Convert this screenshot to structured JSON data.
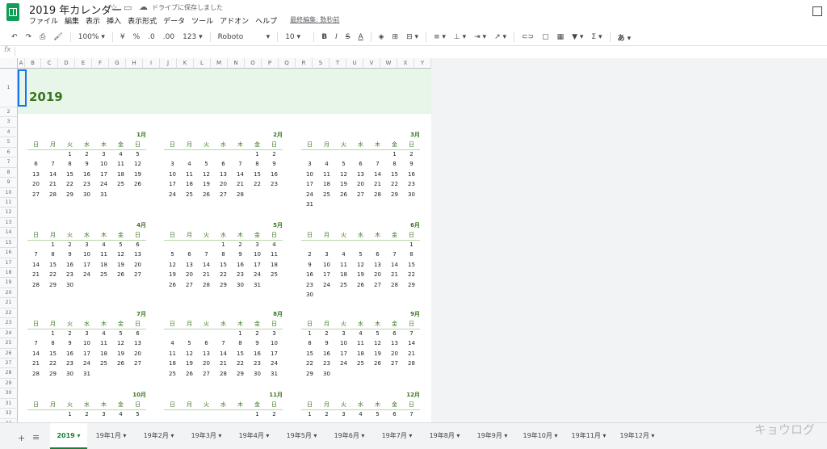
{
  "doc": {
    "title": "2019 年カレンダー",
    "save_status": "ドライブに保存しました",
    "menus": [
      "ファイル",
      "編集",
      "表示",
      "挿入",
      "表示形式",
      "データ",
      "ツール",
      "アドオン",
      "ヘルプ"
    ],
    "last_edit": "最終編集: 数秒前"
  },
  "toolbar": {
    "zoom": "100%",
    "currency": "¥",
    "percent": "%",
    "dec_less": ".0",
    "dec_more": ".00",
    "more_formats": "123",
    "font": "Roboto",
    "font_size": "10",
    "bold": "B",
    "italic": "I",
    "strike": "S",
    "text_color": "A",
    "input_tools": "あ"
  },
  "formula_bar": {
    "label": "fx",
    "value": ""
  },
  "grid": {
    "columns": [
      "A",
      "B",
      "C",
      "D",
      "E",
      "F",
      "G",
      "H",
      "I",
      "J",
      "K",
      "L",
      "M",
      "N",
      "O",
      "P",
      "Q",
      "R",
      "S",
      "T",
      "U",
      "V",
      "W",
      "X",
      "Y"
    ],
    "rows": [
      "1",
      "2",
      "3",
      "4",
      "5",
      "6",
      "7",
      "8",
      "9",
      "10",
      "11",
      "12",
      "13",
      "14",
      "15",
      "16",
      "17",
      "18",
      "19",
      "20",
      "21",
      "22",
      "23",
      "24",
      "25",
      "26",
      "27",
      "28",
      "29",
      "30",
      "31",
      "32",
      "33"
    ]
  },
  "calendar": {
    "year": "2019",
    "weekday_labels": [
      "日",
      "月",
      "火",
      "水",
      "木",
      "金",
      "日"
    ],
    "months": [
      {
        "label": "1月",
        "weeks": [
          [
            "",
            "",
            "1",
            "2",
            "3",
            "4",
            "5"
          ],
          [
            "6",
            "7",
            "8",
            "9",
            "10",
            "11",
            "12"
          ],
          [
            "13",
            "14",
            "15",
            "16",
            "17",
            "18",
            "19"
          ],
          [
            "20",
            "21",
            "22",
            "23",
            "24",
            "25",
            "26"
          ],
          [
            "27",
            "28",
            "29",
            "30",
            "31",
            "",
            ""
          ]
        ]
      },
      {
        "label": "2月",
        "weeks": [
          [
            "",
            "",
            "",
            "",
            "",
            "1",
            "2"
          ],
          [
            "3",
            "4",
            "5",
            "6",
            "7",
            "8",
            "9"
          ],
          [
            "10",
            "11",
            "12",
            "13",
            "14",
            "15",
            "16"
          ],
          [
            "17",
            "18",
            "19",
            "20",
            "21",
            "22",
            "23"
          ],
          [
            "24",
            "25",
            "26",
            "27",
            "28",
            "",
            ""
          ]
        ]
      },
      {
        "label": "3月",
        "weeks": [
          [
            "",
            "",
            "",
            "",
            "",
            "1",
            "2"
          ],
          [
            "3",
            "4",
            "5",
            "6",
            "7",
            "8",
            "9"
          ],
          [
            "10",
            "11",
            "12",
            "13",
            "14",
            "15",
            "16"
          ],
          [
            "17",
            "18",
            "19",
            "20",
            "21",
            "22",
            "23"
          ],
          [
            "24",
            "25",
            "26",
            "27",
            "28",
            "29",
            "30"
          ],
          [
            "31",
            "",
            "",
            "",
            "",
            "",
            ""
          ]
        ]
      },
      {
        "label": "4月",
        "weeks": [
          [
            "",
            "1",
            "2",
            "3",
            "4",
            "5",
            "6"
          ],
          [
            "7",
            "8",
            "9",
            "10",
            "11",
            "12",
            "13"
          ],
          [
            "14",
            "15",
            "16",
            "17",
            "18",
            "19",
            "20"
          ],
          [
            "21",
            "22",
            "23",
            "24",
            "25",
            "26",
            "27"
          ],
          [
            "28",
            "29",
            "30",
            "",
            "",
            "",
            ""
          ]
        ]
      },
      {
        "label": "5月",
        "weeks": [
          [
            "",
            "",
            "",
            "1",
            "2",
            "3",
            "4"
          ],
          [
            "5",
            "6",
            "7",
            "8",
            "9",
            "10",
            "11"
          ],
          [
            "12",
            "13",
            "14",
            "15",
            "16",
            "17",
            "18"
          ],
          [
            "19",
            "20",
            "21",
            "22",
            "23",
            "24",
            "25"
          ],
          [
            "26",
            "27",
            "28",
            "29",
            "30",
            "31",
            ""
          ]
        ]
      },
      {
        "label": "6月",
        "weeks": [
          [
            "",
            "",
            "",
            "",
            "",
            "",
            "1"
          ],
          [
            "2",
            "3",
            "4",
            "5",
            "6",
            "7",
            "8"
          ],
          [
            "9",
            "10",
            "11",
            "12",
            "13",
            "14",
            "15"
          ],
          [
            "16",
            "17",
            "18",
            "19",
            "20",
            "21",
            "22"
          ],
          [
            "23",
            "24",
            "25",
            "26",
            "27",
            "28",
            "29"
          ],
          [
            "30",
            "",
            "",
            "",
            "",
            "",
            ""
          ]
        ]
      },
      {
        "label": "7月",
        "weeks": [
          [
            "",
            "1",
            "2",
            "3",
            "4",
            "5",
            "6"
          ],
          [
            "7",
            "8",
            "9",
            "10",
            "11",
            "12",
            "13"
          ],
          [
            "14",
            "15",
            "16",
            "17",
            "18",
            "19",
            "20"
          ],
          [
            "21",
            "22",
            "23",
            "24",
            "25",
            "26",
            "27"
          ],
          [
            "28",
            "29",
            "30",
            "31",
            "",
            "",
            ""
          ]
        ]
      },
      {
        "label": "8月",
        "weeks": [
          [
            "",
            "",
            "",
            "",
            "1",
            "2",
            "3"
          ],
          [
            "4",
            "5",
            "6",
            "7",
            "8",
            "9",
            "10"
          ],
          [
            "11",
            "12",
            "13",
            "14",
            "15",
            "16",
            "17"
          ],
          [
            "18",
            "19",
            "20",
            "21",
            "22",
            "23",
            "24"
          ],
          [
            "25",
            "26",
            "27",
            "28",
            "29",
            "30",
            "31"
          ]
        ]
      },
      {
        "label": "9月",
        "weeks": [
          [
            "1",
            "2",
            "3",
            "4",
            "5",
            "6",
            "7"
          ],
          [
            "8",
            "9",
            "10",
            "11",
            "12",
            "13",
            "14"
          ],
          [
            "15",
            "16",
            "17",
            "18",
            "19",
            "20",
            "21"
          ],
          [
            "22",
            "23",
            "24",
            "25",
            "26",
            "27",
            "28"
          ],
          [
            "29",
            "30",
            "",
            "",
            "",
            "",
            ""
          ]
        ]
      },
      {
        "label": "10月",
        "weeks": [
          [
            "",
            "",
            "1",
            "2",
            "3",
            "4",
            "5"
          ]
        ]
      },
      {
        "label": "11月",
        "weeks": [
          [
            "",
            "",
            "",
            "",
            "",
            "1",
            "2"
          ]
        ]
      },
      {
        "label": "12月",
        "weeks": [
          [
            "1",
            "2",
            "3",
            "4",
            "5",
            "6",
            "7"
          ]
        ]
      }
    ]
  },
  "sheet_tabs": [
    "2019",
    "19年1月",
    "19年2月",
    "19年3月",
    "19年4月",
    "19年5月",
    "19年6月",
    "19年7月",
    "19年8月",
    "19年9月",
    "19年10月",
    "19年11月",
    "19年12月"
  ],
  "active_tab": "2019",
  "watermark": "キョウログ",
  "colors": {
    "accent": "#38761d",
    "band": "#e8f5e9",
    "selection": "#1a73e8"
  }
}
